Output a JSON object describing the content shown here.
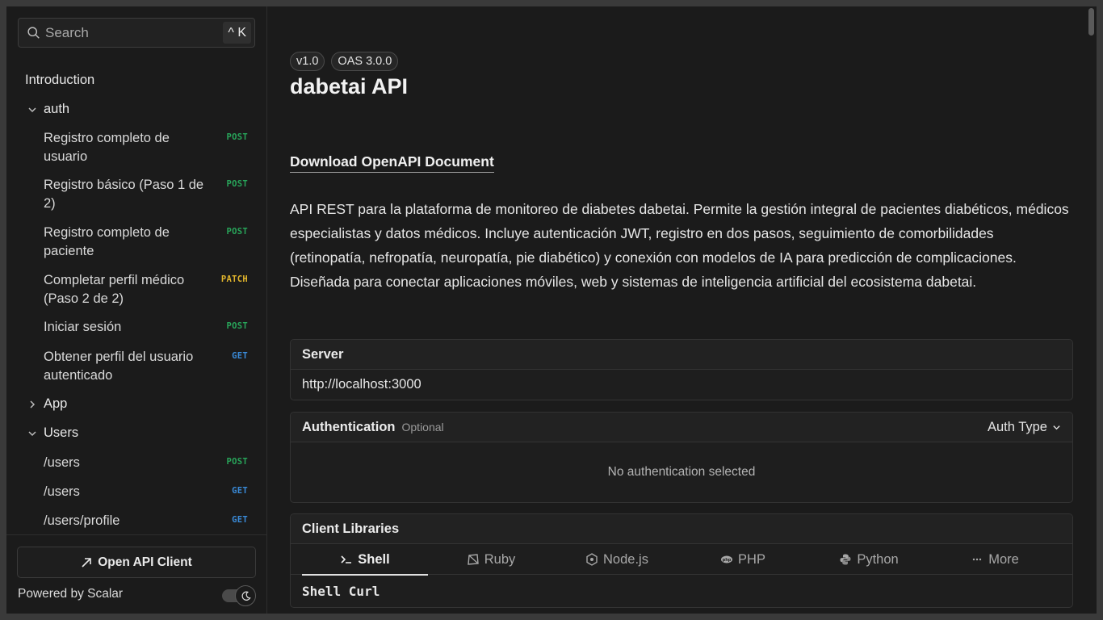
{
  "search": {
    "placeholder": "Search",
    "shortcut": "^ K"
  },
  "nav": {
    "introduction": "Introduction",
    "groups": [
      {
        "name": "auth",
        "expanded": true,
        "items": [
          {
            "label": "Registro completo de usuario",
            "method": "POST"
          },
          {
            "label": "Registro básico (Paso 1 de 2)",
            "method": "POST"
          },
          {
            "label": "Registro completo de paciente",
            "method": "POST"
          },
          {
            "label": "Completar perfil médico (Paso 2 de 2)",
            "method": "PATCH"
          },
          {
            "label": "Iniciar sesión",
            "method": "POST"
          },
          {
            "label": "Obtener perfil del usuario autenticado",
            "method": "GET"
          }
        ]
      },
      {
        "name": "App",
        "expanded": false,
        "items": []
      },
      {
        "name": "Users",
        "expanded": true,
        "items": [
          {
            "label": "/users",
            "method": "POST"
          },
          {
            "label": "/users",
            "method": "GET"
          },
          {
            "label": "/users/profile",
            "method": "GET"
          }
        ]
      }
    ]
  },
  "footer": {
    "open_client": "Open API Client",
    "powered_by": "Powered by Scalar",
    "dark_mode": true
  },
  "main": {
    "version": "v1.0",
    "oas": "OAS 3.0.0",
    "title": "dabetai API",
    "download": "Download OpenAPI Document",
    "description": "API REST para la plataforma de monitoreo de diabetes dabetai. Permite la gestión integral de pacientes diabéticos, médicos especialistas y datos médicos. Incluye autenticación JWT, registro en dos pasos, seguimiento de comorbilidades (retinopatía, nefropatía, neuropatía, pie diabético) y conexión con modelos de IA para predicción de complicaciones. Diseñada para conectar aplicaciones móviles, web y sistemas de inteligencia artificial del ecosistema dabetai.",
    "server": {
      "heading": "Server",
      "url": "http://localhost:3000"
    },
    "auth": {
      "heading": "Authentication",
      "optional": "Optional",
      "type_label": "Auth Type",
      "empty": "No authentication selected"
    },
    "clients": {
      "heading": "Client Libraries",
      "tabs": [
        "Shell",
        "Ruby",
        "Node.js",
        "PHP",
        "Python",
        "More"
      ],
      "active_tab": "Shell",
      "subtitle": "Shell Curl"
    }
  },
  "colors": {
    "post": "#28a55a",
    "get": "#3a8bd9",
    "patch": "#e1b52c",
    "background": "#1b1b1b"
  }
}
